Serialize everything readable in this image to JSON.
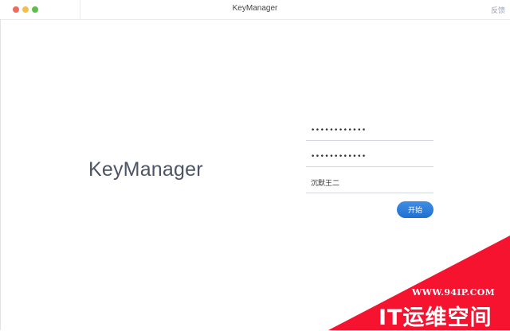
{
  "window": {
    "title": "KeyManager",
    "feedback_label": "反馈"
  },
  "main": {
    "brand": "KeyManager",
    "field1_value": "••••••••••••",
    "field2_value": "••••••••••••",
    "field3_value": "沉默王二",
    "start_label": "开始"
  },
  "watermark": {
    "url": "WWW.94IP.COM",
    "brand": "IT运维空间",
    "color": "#f5132f"
  },
  "colors": {
    "accent": "#2a7bdc",
    "traffic_red": "#f06a5f",
    "traffic_yellow": "#f4be4f",
    "traffic_green": "#5dc04e"
  }
}
